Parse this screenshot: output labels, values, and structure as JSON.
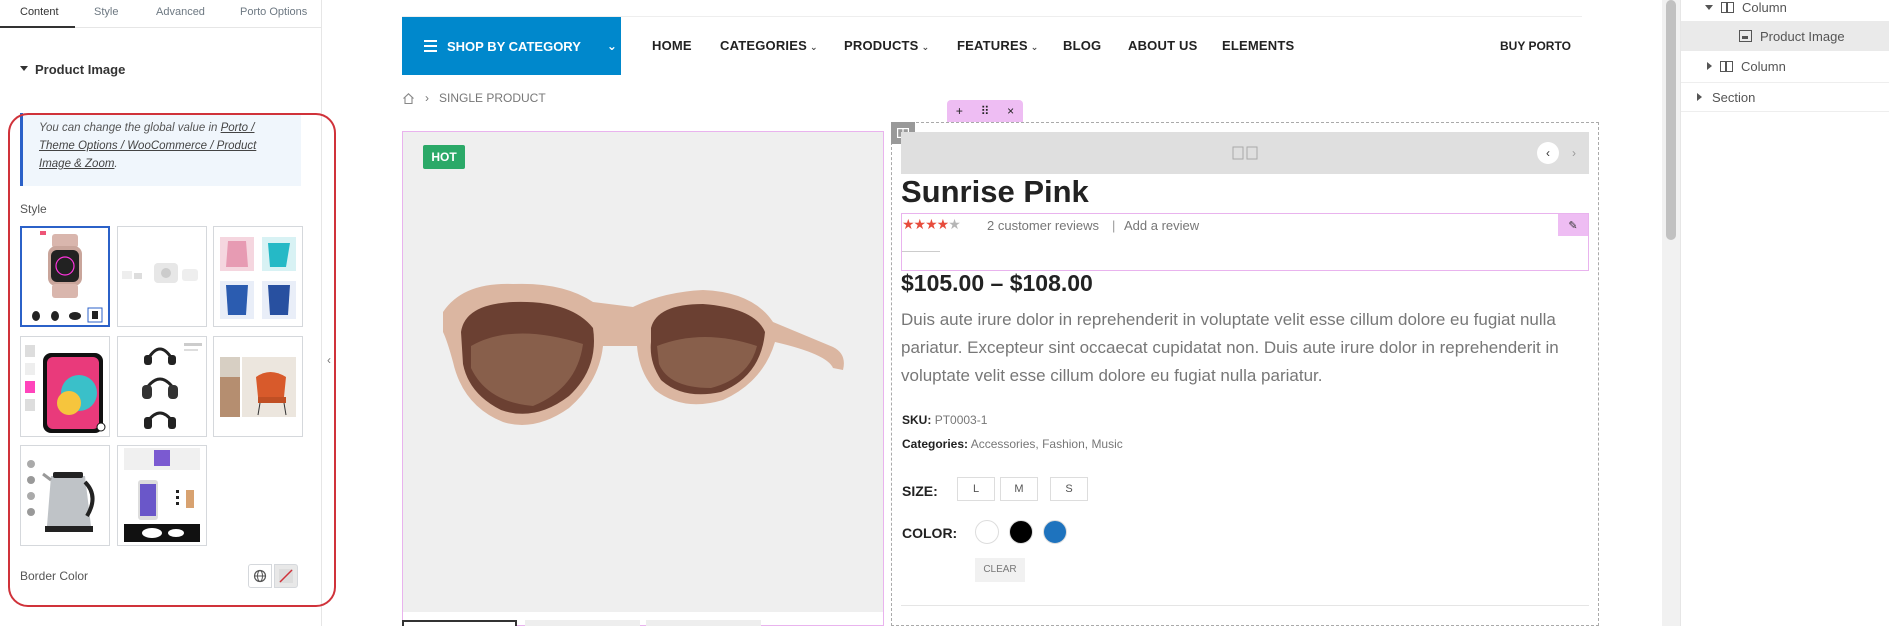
{
  "left_panel": {
    "tabs": [
      "Content",
      "Style",
      "Advanced",
      "Porto Options"
    ],
    "section_title": "Product Image",
    "notice": {
      "prefix": "You can change the global value in ",
      "link": "Porto / Theme Options / WooCommerce / Product Image & Zoom",
      "suffix": "."
    },
    "style_label": "Style",
    "style_thumbnails": [
      {
        "name": "watch-layout",
        "selected": true
      },
      {
        "name": "earbuds-layout",
        "selected": false
      },
      {
        "name": "clothing-grid-layout",
        "selected": false
      },
      {
        "name": "phone-layout",
        "selected": false
      },
      {
        "name": "headphones-layout",
        "selected": false
      },
      {
        "name": "chair-layout",
        "selected": false
      },
      {
        "name": "kettle-layout",
        "selected": false
      },
      {
        "name": "phone-stack-layout",
        "selected": false
      }
    ],
    "border_color_label": "Border Color"
  },
  "header": {
    "shop_by_category": "SHOP BY CATEGORY",
    "nav": [
      {
        "label": "HOME",
        "dropdown": false
      },
      {
        "label": "CATEGORIES",
        "dropdown": true
      },
      {
        "label": "PRODUCTS",
        "dropdown": true
      },
      {
        "label": "FEATURES",
        "dropdown": true
      },
      {
        "label": "BLOG",
        "dropdown": false
      },
      {
        "label": "ABOUT US",
        "dropdown": false
      },
      {
        "label": "ELEMENTS",
        "dropdown": false
      }
    ],
    "buy_label": "BUY PORTO"
  },
  "breadcrumb": {
    "current": "SINGLE PRODUCT"
  },
  "product": {
    "badge": "HOT",
    "title": "Sunrise Pink",
    "rating": 4.5,
    "review_count_text": "2 customer reviews",
    "separator": "|",
    "add_review": "Add a review",
    "price": "$105.00 – $108.00",
    "description": "Duis aute irure dolor in reprehenderit in voluptate velit esse cillum dolore eu fugiat nulla pariatur. Excepteur sint occaecat cupidatat non. Duis aute irure dolor in reprehenderit in voluptate velit esse cillum dolore eu fugiat nulla pariatur.",
    "sku_label": "SKU:",
    "sku": "PT0003-1",
    "categories_label": "Categories:",
    "categories": [
      "Accessories",
      "Fashion",
      "Music"
    ],
    "size_label": "SIZE:",
    "sizes": [
      "L",
      "M",
      "S"
    ],
    "color_label": "COLOR:",
    "colors": [
      "#ffffff",
      "#000000",
      "#1e73be"
    ],
    "clear_label": "CLEAR"
  },
  "navigator": {
    "items": [
      {
        "label": "Column",
        "expanded": true
      },
      {
        "label": "Product Image",
        "selected": true
      },
      {
        "label": "Column",
        "expanded": false
      },
      {
        "label": "Section",
        "expanded": false
      }
    ]
  }
}
